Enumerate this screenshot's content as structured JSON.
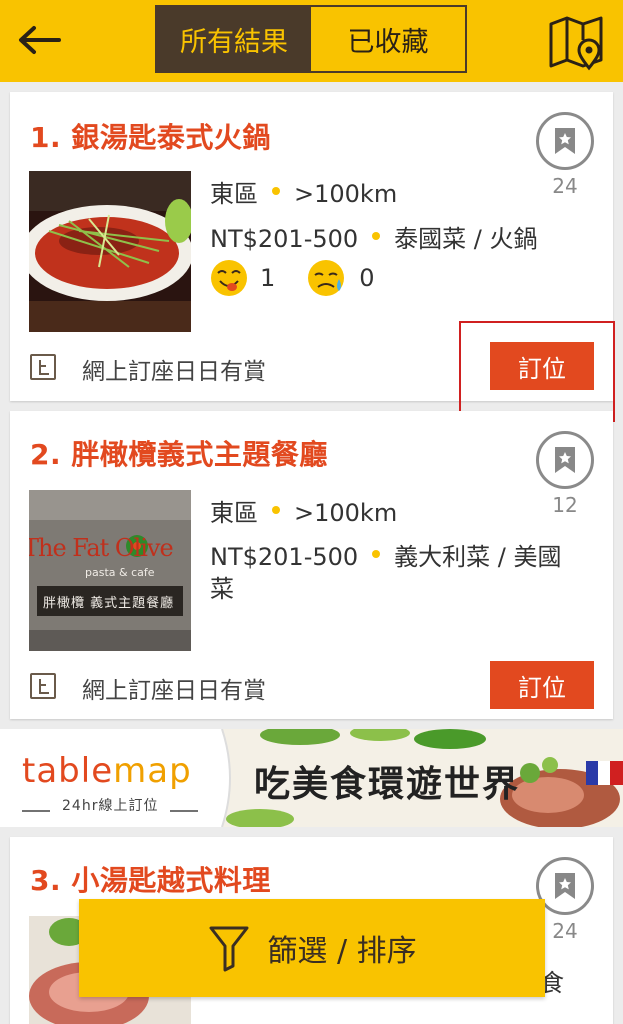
{
  "header": {
    "tab_all": "所有結果",
    "tab_saved": "已收藏",
    "accent_color": "#f9c300",
    "dark_color": "#4a3a2a"
  },
  "restaurants": [
    {
      "title": "1. 銀湯匙泰式火鍋",
      "bookmark_count": "24",
      "area": "東區",
      "distance": ">100km",
      "price": "NT$201-500",
      "cuisine": "泰國菜 / 火鍋",
      "like_count": "1",
      "dislike_count": "0",
      "reward_text": "網上訂座日日有賞",
      "book_label": "訂位"
    },
    {
      "title": "2. 胖橄欖義式主題餐廳",
      "bookmark_count": "12",
      "area": "東區",
      "distance": ">100km",
      "price": "NT$201-500",
      "cuisine_line1": "義大利菜 / 美國",
      "cuisine_line2": "菜",
      "reward_text": "網上訂座日日有賞",
      "book_label": "訂位",
      "photo_text": "The Fat Olive",
      "photo_sub": "pasta & cafe",
      "photo_sign": "胖橄欖 義式主題餐廳"
    },
    {
      "title": "3. 小湯匙越式料理",
      "bookmark_count": "24",
      "partial_text": "食"
    }
  ],
  "banner": {
    "brand_table": "table",
    "brand_map": "map",
    "sub": "24hr線上訂位",
    "slogan": "吃美食環遊世界"
  },
  "filter": {
    "label": "篩選 / 排序"
  },
  "colors": {
    "title_red": "#e2491f",
    "highlight_red": "#d02020"
  }
}
